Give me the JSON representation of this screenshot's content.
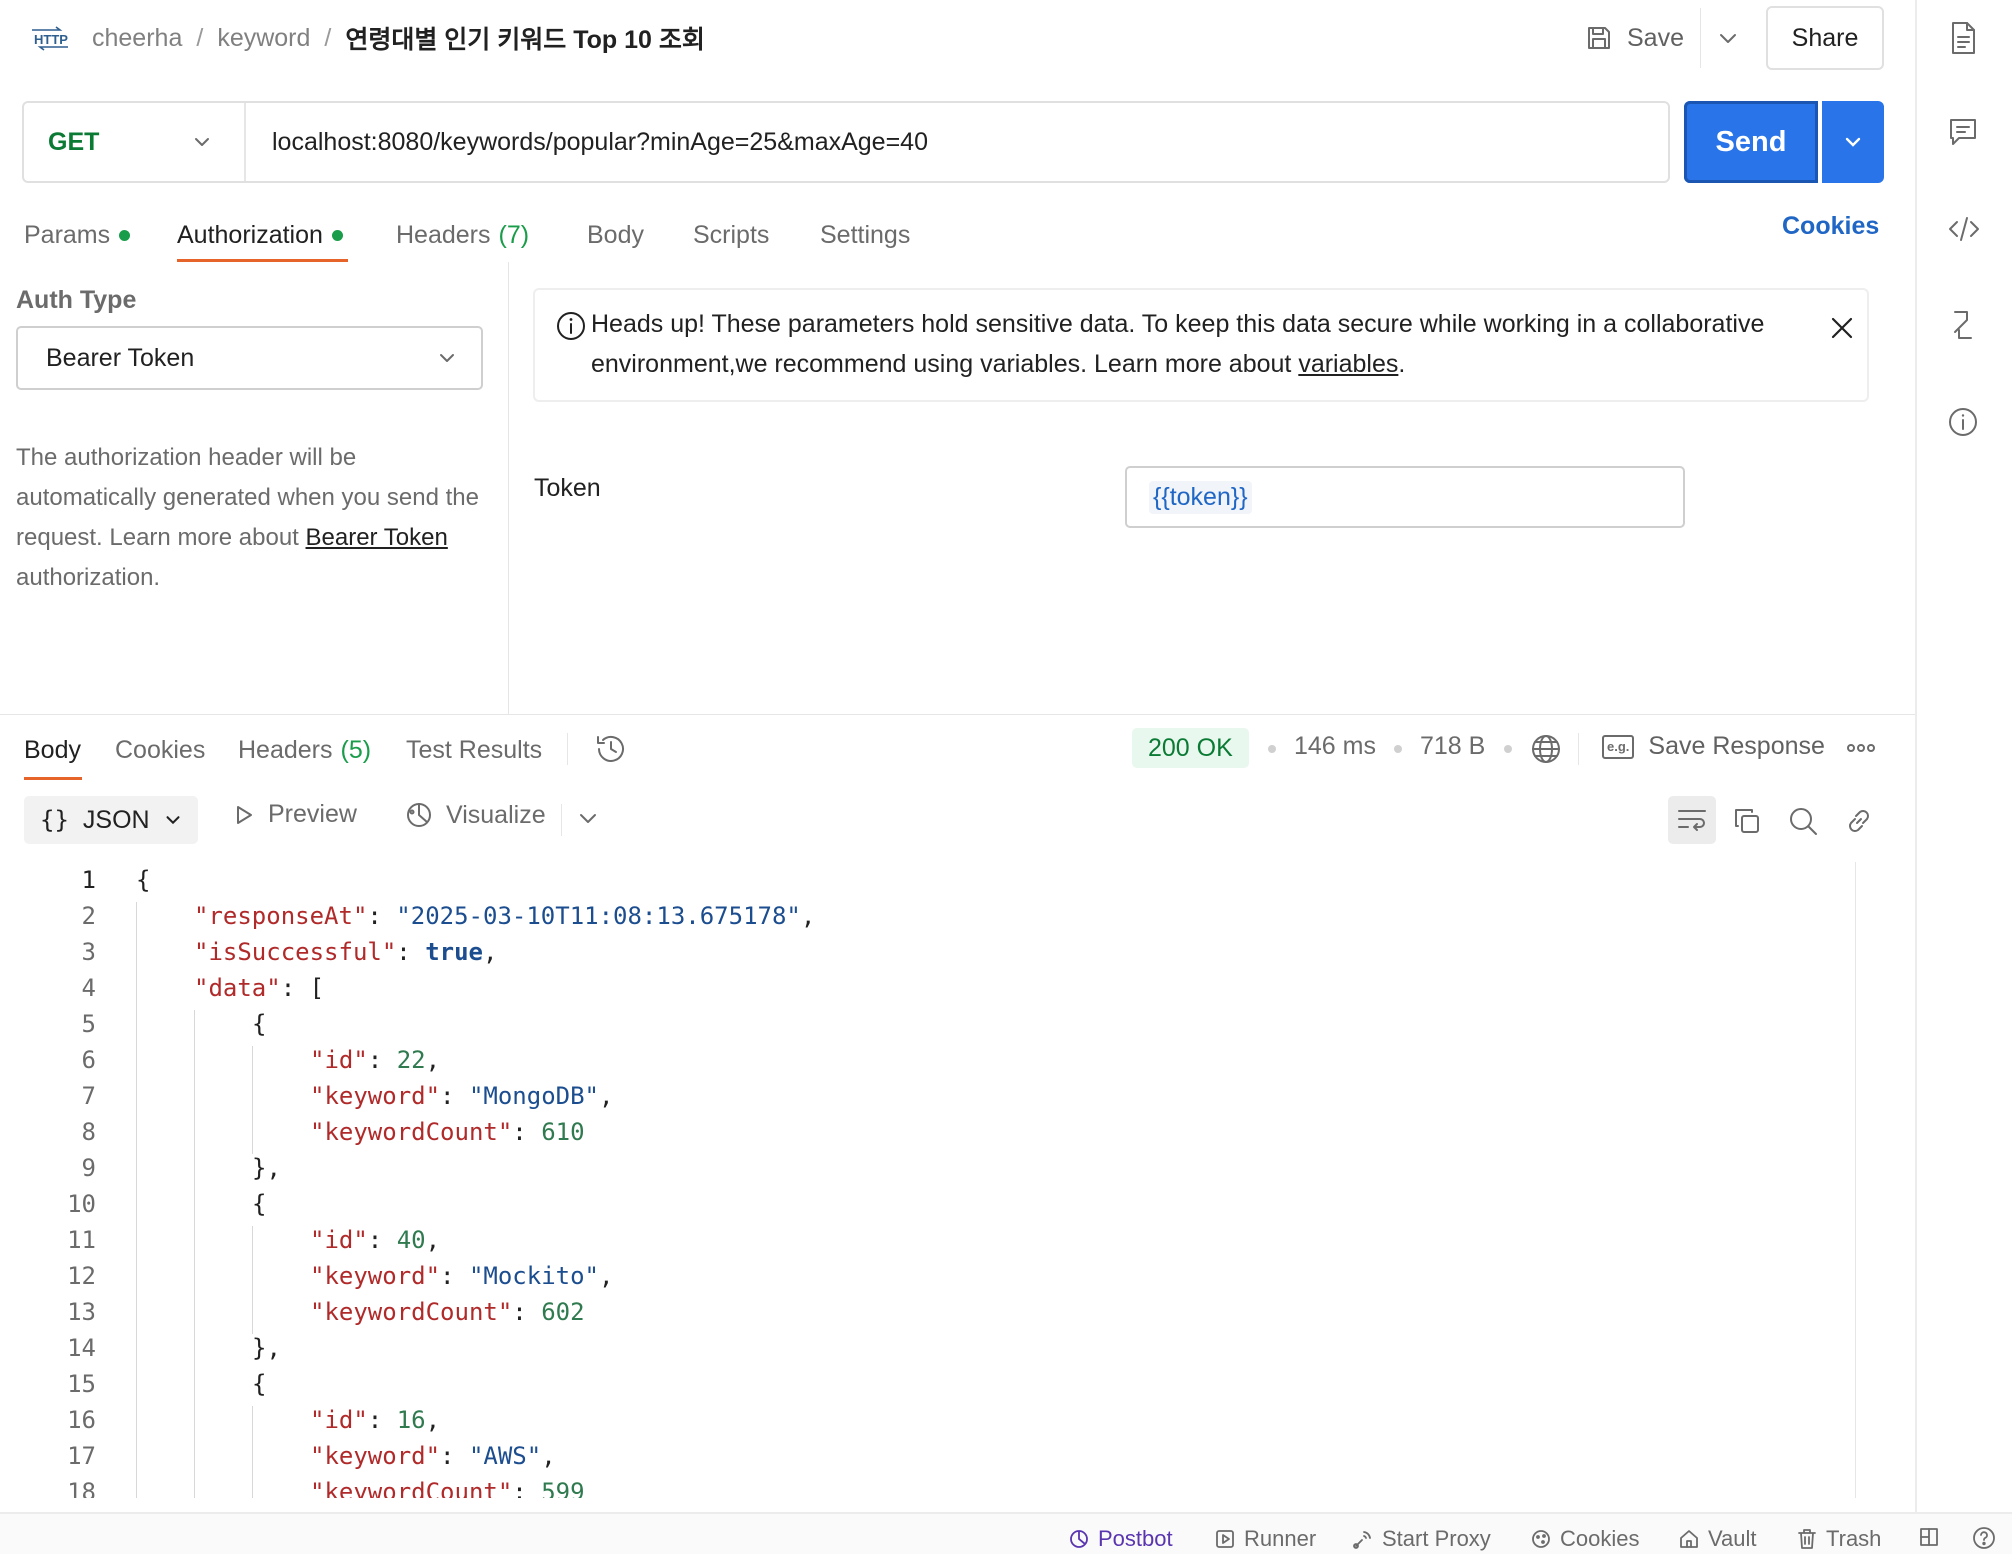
{
  "breadcrumb": {
    "workspace": "cheerha",
    "collection": "keyword",
    "request": "연령대별 인기 키워드 Top 10 조회"
  },
  "toolbar": {
    "save_label": "Save",
    "share_label": "Share"
  },
  "request": {
    "method": "GET",
    "url": "localhost:8080/keywords/popular?minAge=25&maxAge=40",
    "send_label": "Send"
  },
  "request_tabs": {
    "params": "Params",
    "authorization": "Authorization",
    "headers": "Headers",
    "headers_count": "(7)",
    "body": "Body",
    "scripts": "Scripts",
    "settings": "Settings",
    "cookies": "Cookies"
  },
  "auth": {
    "type_label": "Auth Type",
    "type_value": "Bearer Token",
    "help_text": "The authorization header will be automatically generated when you send the request. Learn more about ",
    "help_link": "Bearer Token",
    "help_suffix": " authorization.",
    "headsup_text": "Heads up! These parameters hold sensitive data. To keep this data secure while working in a collaborative environment,we recommend using variables. Learn more about ",
    "headsup_link": "variables",
    "headsup_suffix": ".",
    "token_label": "Token",
    "token_value": "{{token}}"
  },
  "response_tabs": {
    "body": "Body",
    "cookies": "Cookies",
    "headers": "Headers",
    "headers_count": "(5)",
    "test_results": "Test Results"
  },
  "response_meta": {
    "status": "200 OK",
    "time": "146 ms",
    "size": "718 B",
    "save_response": "Save Response",
    "eg_badge": "e.g."
  },
  "body_toolbar": {
    "format": "JSON",
    "preview": "Preview",
    "visualize": "Visualize"
  },
  "code_lines": [
    {
      "n": "1",
      "indent": 0,
      "parts": [
        [
          "p",
          "{"
        ]
      ]
    },
    {
      "n": "2",
      "indent": 1,
      "parts": [
        [
          "k",
          "\"responseAt\""
        ],
        [
          "p",
          ": "
        ],
        [
          "s",
          "\"2025-03-10T11:08:13.675178\""
        ],
        [
          "p",
          ","
        ]
      ]
    },
    {
      "n": "3",
      "indent": 1,
      "parts": [
        [
          "k",
          "\"isSuccessful\""
        ],
        [
          "p",
          ": "
        ],
        [
          "b",
          "true"
        ],
        [
          "p",
          ","
        ]
      ]
    },
    {
      "n": "4",
      "indent": 1,
      "parts": [
        [
          "k",
          "\"data\""
        ],
        [
          "p",
          ": ["
        ]
      ]
    },
    {
      "n": "5",
      "indent": 2,
      "parts": [
        [
          "p",
          "{"
        ]
      ]
    },
    {
      "n": "6",
      "indent": 3,
      "parts": [
        [
          "k",
          "\"id\""
        ],
        [
          "p",
          ": "
        ],
        [
          "n",
          "22"
        ],
        [
          "p",
          ","
        ]
      ]
    },
    {
      "n": "7",
      "indent": 3,
      "parts": [
        [
          "k",
          "\"keyword\""
        ],
        [
          "p",
          ": "
        ],
        [
          "s",
          "\"MongoDB\""
        ],
        [
          "p",
          ","
        ]
      ]
    },
    {
      "n": "8",
      "indent": 3,
      "parts": [
        [
          "k",
          "\"keywordCount\""
        ],
        [
          "p",
          ": "
        ],
        [
          "n",
          "610"
        ]
      ]
    },
    {
      "n": "9",
      "indent": 2,
      "parts": [
        [
          "p",
          "},"
        ]
      ]
    },
    {
      "n": "10",
      "indent": 2,
      "parts": [
        [
          "p",
          "{"
        ]
      ]
    },
    {
      "n": "11",
      "indent": 3,
      "parts": [
        [
          "k",
          "\"id\""
        ],
        [
          "p",
          ": "
        ],
        [
          "n",
          "40"
        ],
        [
          "p",
          ","
        ]
      ]
    },
    {
      "n": "12",
      "indent": 3,
      "parts": [
        [
          "k",
          "\"keyword\""
        ],
        [
          "p",
          ": "
        ],
        [
          "s",
          "\"Mockito\""
        ],
        [
          "p",
          ","
        ]
      ]
    },
    {
      "n": "13",
      "indent": 3,
      "parts": [
        [
          "k",
          "\"keywordCount\""
        ],
        [
          "p",
          ": "
        ],
        [
          "n",
          "602"
        ]
      ]
    },
    {
      "n": "14",
      "indent": 2,
      "parts": [
        [
          "p",
          "},"
        ]
      ]
    },
    {
      "n": "15",
      "indent": 2,
      "parts": [
        [
          "p",
          "{"
        ]
      ]
    },
    {
      "n": "16",
      "indent": 3,
      "parts": [
        [
          "k",
          "\"id\""
        ],
        [
          "p",
          ": "
        ],
        [
          "n",
          "16"
        ],
        [
          "p",
          ","
        ]
      ]
    },
    {
      "n": "17",
      "indent": 3,
      "parts": [
        [
          "k",
          "\"keyword\""
        ],
        [
          "p",
          ": "
        ],
        [
          "s",
          "\"AWS\""
        ],
        [
          "p",
          ","
        ]
      ]
    },
    {
      "n": "18",
      "indent": 3,
      "parts": [
        [
          "k",
          "\"keywordCount\""
        ],
        [
          "p",
          ": "
        ],
        [
          "n",
          "599"
        ]
      ]
    }
  ],
  "statusbar": {
    "postbot": "Postbot",
    "runner": "Runner",
    "start_proxy": "Start Proxy",
    "cookies": "Cookies",
    "vault": "Vault",
    "trash": "Trash"
  },
  "icons": {
    "http": "http-icon",
    "save": "save-icon",
    "chevron": "chevron-down-icon",
    "info": "info-icon",
    "close": "close-icon",
    "history": "history-icon",
    "globe": "globe-icon",
    "wrap": "wrap-lines-icon",
    "copy": "copy-icon",
    "search": "search-icon",
    "link": "link-icon",
    "more": "more-icon",
    "docs": "document-icon",
    "comments": "comment-icon",
    "code": "code-icon",
    "related": "related-requests-icon",
    "details": "info-icon"
  },
  "colors": {
    "accent": "#2874e8",
    "tab_active": "#e6632a",
    "success": "#1a9d4a",
    "method_get": "#0b7a34",
    "link": "#1f66c5"
  }
}
